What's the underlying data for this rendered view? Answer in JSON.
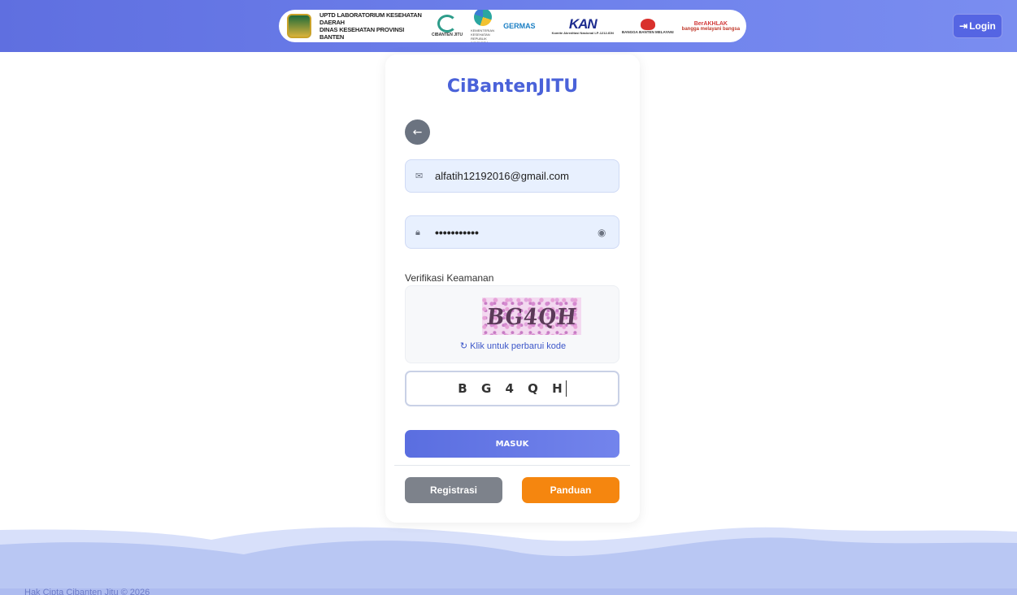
{
  "header": {
    "institution_line1": "UPTD LABORATORIUM KESEHATAN DAERAH",
    "institution_line2": "DINAS KESEHATAN PROVINSI BANTEN",
    "logos": {
      "cibanten": "CIBANTEN JITU",
      "kemenkes": "KEMENTERIAN KESEHATAN REPUBLIK INDONESIA",
      "germas": "GERMAS",
      "kan": "KAN",
      "kan_caption": "Komite Akreditasi Nasional LP-1212-IDN",
      "bangga_banten": "BANGGA BANTEN MELAYANI",
      "berakhlak": "BerAKHLAK",
      "bangga_melayani": "bangga melayani bangsa"
    },
    "login_label": "Login",
    "login_icon": "sign-in-icon"
  },
  "form": {
    "title": "CiBantenJITU",
    "back_icon": "arrow-left-icon",
    "email_icon": "envelope-icon",
    "email_value": "alfatih12192016@gmail.com",
    "password_icon": "lock-icon",
    "password_value": "•••••••••••",
    "toggle_icon": "eye-icon",
    "verification_label": "Verifikasi Keamanan",
    "captcha_image_text": "BG4QH",
    "refresh_icon": "refresh-icon",
    "refresh_label": "Klik untuk perbarui kode",
    "captcha_input_value": "BG4QH",
    "submit_label": "MASUK",
    "register_label": "Registrasi",
    "guide_label": "Panduan"
  },
  "footer": {
    "copyright": "Hak Cipta Cibanten Jitu © 2026"
  },
  "colors": {
    "header_bg": "#6f82ec",
    "title": "#4a62d9",
    "submit": "#5a6ee0",
    "register": "#7d828b",
    "guide": "#f5860f",
    "wave": "#b9c7f3"
  }
}
